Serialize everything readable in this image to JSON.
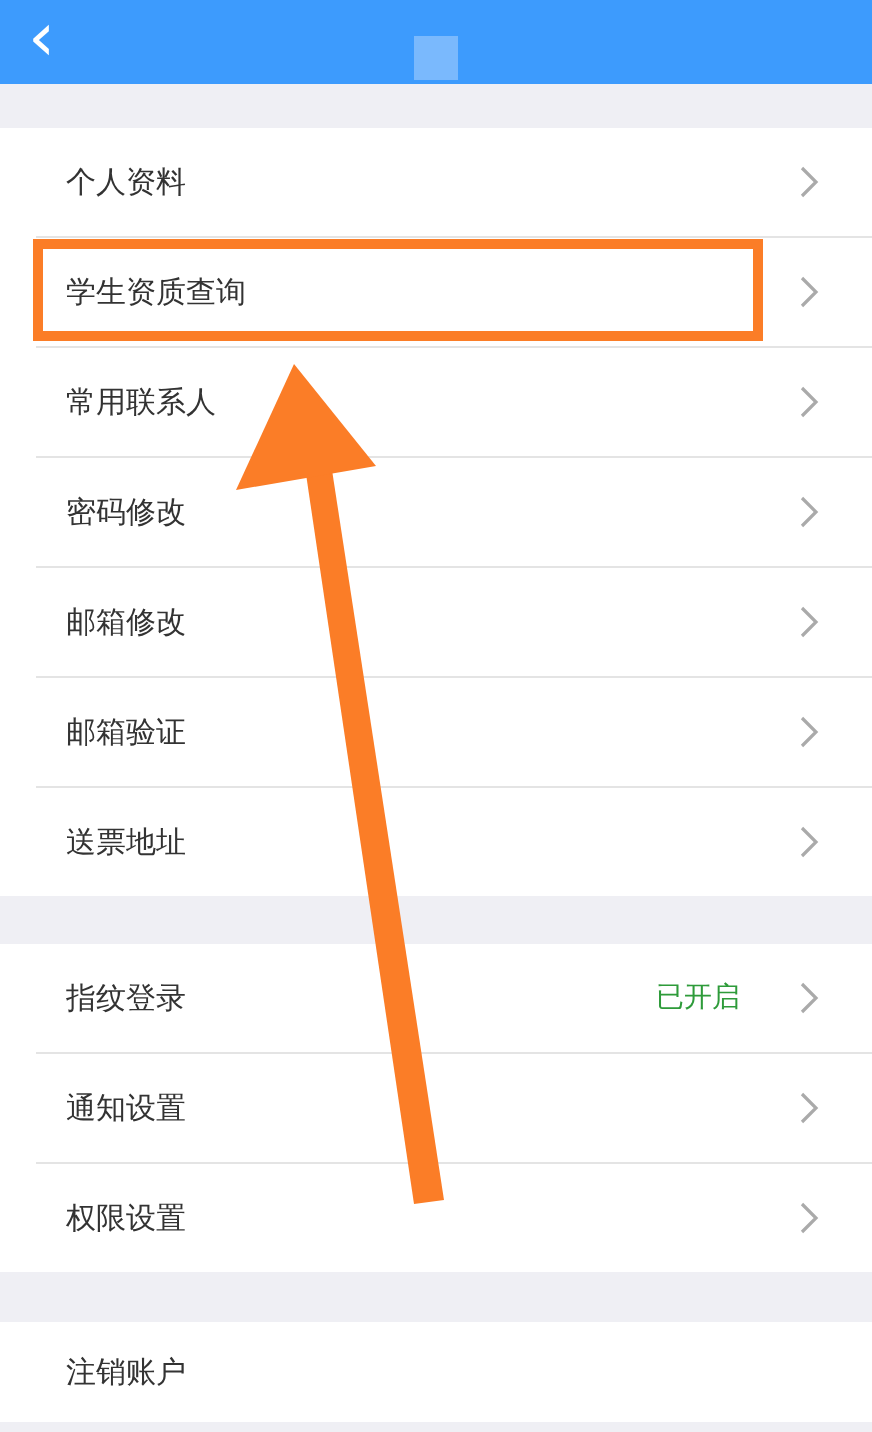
{
  "header": {
    "back_icon": "‹"
  },
  "groups": [
    {
      "rows": [
        {
          "label": "个人资料",
          "chevron": true,
          "highlighted": false
        },
        {
          "label": "学生资质查询",
          "chevron": true,
          "highlighted": true
        },
        {
          "label": "常用联系人",
          "chevron": true,
          "highlighted": false
        },
        {
          "label": "密码修改",
          "chevron": true,
          "highlighted": false
        },
        {
          "label": "邮箱修改",
          "chevron": true,
          "highlighted": false
        },
        {
          "label": "邮箱验证",
          "chevron": true,
          "highlighted": false
        },
        {
          "label": "送票地址",
          "chevron": true,
          "highlighted": false
        }
      ]
    },
    {
      "rows": [
        {
          "label": "指纹登录",
          "status": "已开启",
          "chevron": true,
          "highlighted": false
        },
        {
          "label": "通知设置",
          "chevron": true,
          "highlighted": false
        },
        {
          "label": "权限设置",
          "chevron": true,
          "highlighted": false
        }
      ]
    },
    {
      "rows": [
        {
          "label": "注销账户",
          "chevron": false,
          "highlighted": false
        }
      ]
    }
  ]
}
